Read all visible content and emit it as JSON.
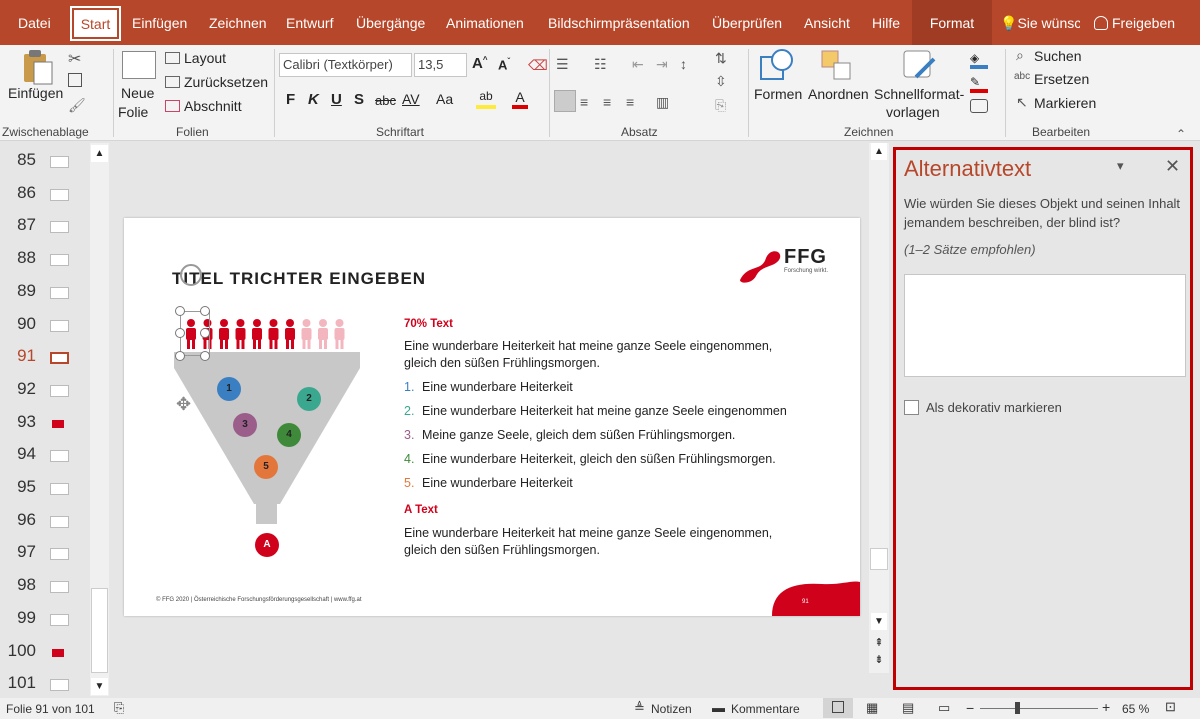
{
  "tabs": [
    "Datei",
    "Start",
    "Einfügen",
    "Zeichnen",
    "Entwurf",
    "Übergänge",
    "Animationen",
    "Bildschirmpräsentation",
    "Überprüfen",
    "Ansicht",
    "Hilfe",
    "Format"
  ],
  "tell_me": "Sie wünsc",
  "share": "Freigeben",
  "ribbon": {
    "clipboard": {
      "paste": "Einfügen",
      "group": "Zwischenablage"
    },
    "slides": {
      "new_slide_1": "Neue",
      "new_slide_2": "Folie",
      "layout": "Layout",
      "reset": "Zurücksetzen",
      "section": "Abschnitt",
      "group": "Folien"
    },
    "font": {
      "name": "Calibri (Textkörper)",
      "size": "13,5",
      "bold": "F",
      "italic": "K",
      "underline": "U",
      "shadow": "S",
      "strike": "abc",
      "group": "Schriftart"
    },
    "paragraph": {
      "group": "Absatz"
    },
    "drawing": {
      "shapes": "Formen",
      "arrange": "Anordnen",
      "quick_1": "Schnellformat-",
      "quick_2": "vorlagen",
      "group": "Zeichnen"
    },
    "editing": {
      "find": "Suchen",
      "replace": "Ersetzen",
      "select": "Markieren",
      "group": "Bearbeiten"
    }
  },
  "thumbnails": [
    "85",
    "86",
    "87",
    "88",
    "89",
    "90",
    "91",
    "92",
    "93",
    "94",
    "95",
    "96",
    "97",
    "98",
    "99",
    "100",
    "101"
  ],
  "active_slide": "91",
  "slide": {
    "title": "TITEL TRICHTER EINGEBEN",
    "logo": "FFG",
    "logo_sub": "Forschung wirkt.",
    "heading1": "70% Text",
    "para1_a": "Eine wunderbare Heiterkeit hat meine ganze Seele eingenommen,",
    "para1_b": "gleich den süßen Frühlingsmorgen.",
    "list": [
      {
        "n": "1.",
        "text": "Eine wunderbare Heiterkeit",
        "color": "#3a7fc2"
      },
      {
        "n": "2.",
        "text": "Eine wunderbare Heiterkeit hat meine ganze Seele eingenommen",
        "color": "#3aa88f"
      },
      {
        "n": "3.",
        "text": "Meine ganze Seele, gleich dem süßen Frühlingsmorgen.",
        "color": "#9b5d8a"
      },
      {
        "n": "4.",
        "text": "Eine wunderbare Heiterkeit, gleich den süßen Frühlingsmorgen.",
        "color": "#3f8a3a"
      },
      {
        "n": "5.",
        "text": "Eine wunderbare Heiterkeit",
        "color": "#e3763b"
      }
    ],
    "heading2": "A Text",
    "para2_a": "Eine wunderbare Heiterkeit hat meine ganze Seele eingenommen,",
    "para2_b": "gleich den süßen Frühlingsmorgen.",
    "funnel_numbers": [
      "1",
      "2",
      "3",
      "4",
      "5"
    ],
    "funnel_output": "A",
    "footer": "© FFG 2020 | Österreichische Forschungsförderungsgesellschaft | www.ffg.at",
    "page_number": "91"
  },
  "pane": {
    "title": "Alternativtext",
    "question": "Wie würden Sie dieses Objekt und seinen Inhalt jemandem beschreiben, der blind ist?",
    "hint": "(1–2 Sätze empfohlen)",
    "textbox_value": "",
    "decorative_label": "Als dekorativ markieren"
  },
  "status": {
    "slide_info": "Folie 91 von 101",
    "notes": "Notizen",
    "comments": "Kommentare",
    "zoom": "65 %"
  },
  "colors": {
    "accent": "#b7472a",
    "ffg_red": "#d0021b",
    "pane_border": "#c00000"
  }
}
